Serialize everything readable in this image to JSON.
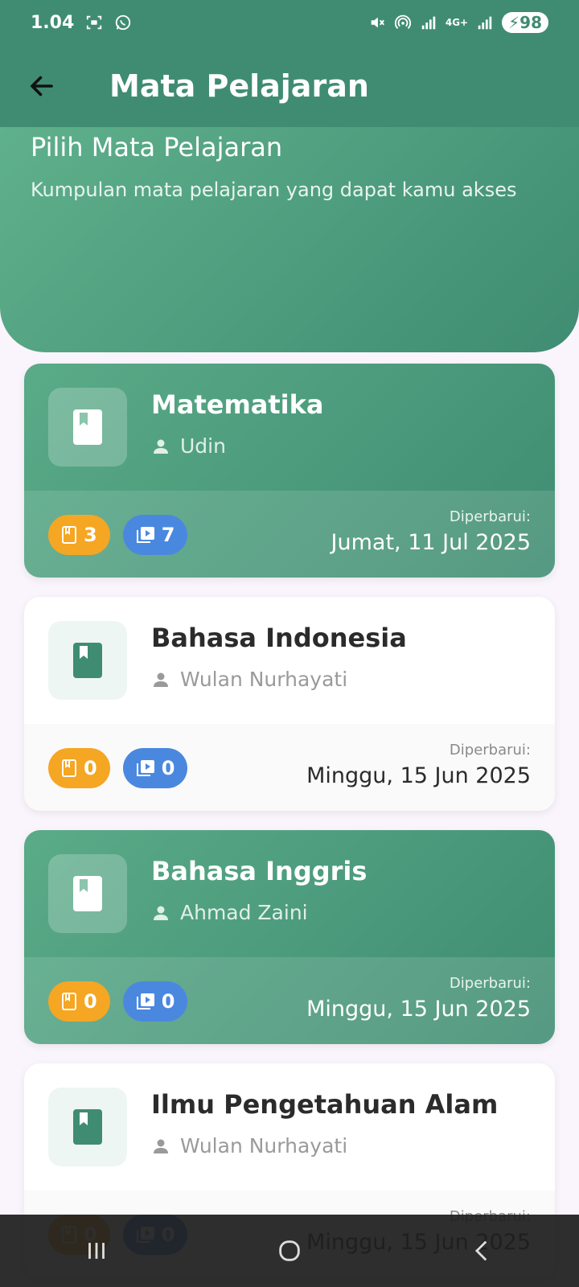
{
  "status": {
    "time": "1.04",
    "network": "4G+",
    "battery": "98"
  },
  "appbar": {
    "title": "Mata Pelajaran"
  },
  "hero": {
    "title": "Pilih Mata Pelajaran",
    "subtitle": "Kumpulan mata pelajaran yang dapat kamu akses"
  },
  "updated_label": "Diperbarui:",
  "subjects": [
    {
      "name": "Matematika",
      "teacher": "Udin",
      "materials": "3",
      "videos": "7",
      "updated": "Jumat, 11 Jul 2025",
      "highlighted": true
    },
    {
      "name": "Bahasa Indonesia",
      "teacher": "Wulan Nurhayati",
      "materials": "0",
      "videos": "0",
      "updated": "Minggu, 15 Jun 2025",
      "highlighted": false
    },
    {
      "name": "Bahasa Inggris",
      "teacher": "Ahmad Zaini",
      "materials": "0",
      "videos": "0",
      "updated": "Minggu, 15 Jun 2025",
      "highlighted": true
    },
    {
      "name": "Ilmu Pengetahuan Alam",
      "teacher": "Wulan Nurhayati",
      "materials": "0",
      "videos": "0",
      "updated": "Minggu, 15 Jun 2025",
      "highlighted": false
    }
  ],
  "colors": {
    "primary": "#3f8c72",
    "material_badge": "#f5a623",
    "video_badge": "#4a88e0"
  }
}
